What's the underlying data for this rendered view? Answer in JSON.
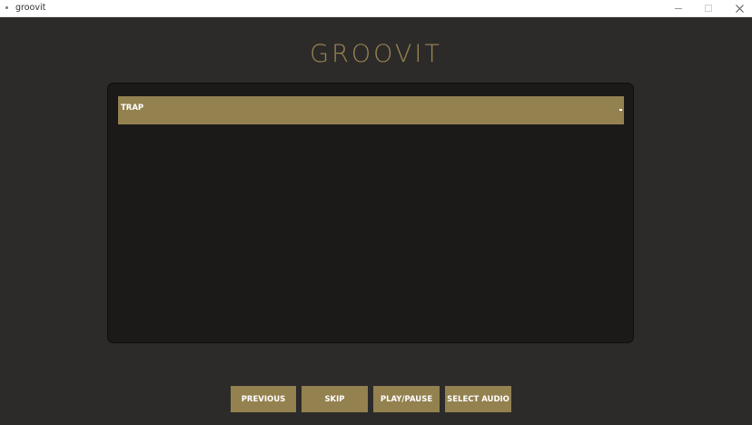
{
  "window": {
    "title": "groovit",
    "app_icon": "app-icon",
    "controls": [
      "minimize-icon",
      "maximize-icon",
      "close-icon"
    ]
  },
  "header": {
    "logo_text": "GROOVIT"
  },
  "playlist": {
    "genre_dropdown": {
      "selected": "TRAP",
      "icon": "chevron-down-icon"
    }
  },
  "controls": {
    "previous_label": "PREVIOUS",
    "skip_label": "SKIP",
    "play_pause_label": "PLAY/PAUSE",
    "select_audio_label": "SELECT AUDIO"
  },
  "colors": {
    "accent": "#93814f",
    "logo": "#9a8452",
    "background": "#2c2b29",
    "panel": "#1b1a18"
  }
}
